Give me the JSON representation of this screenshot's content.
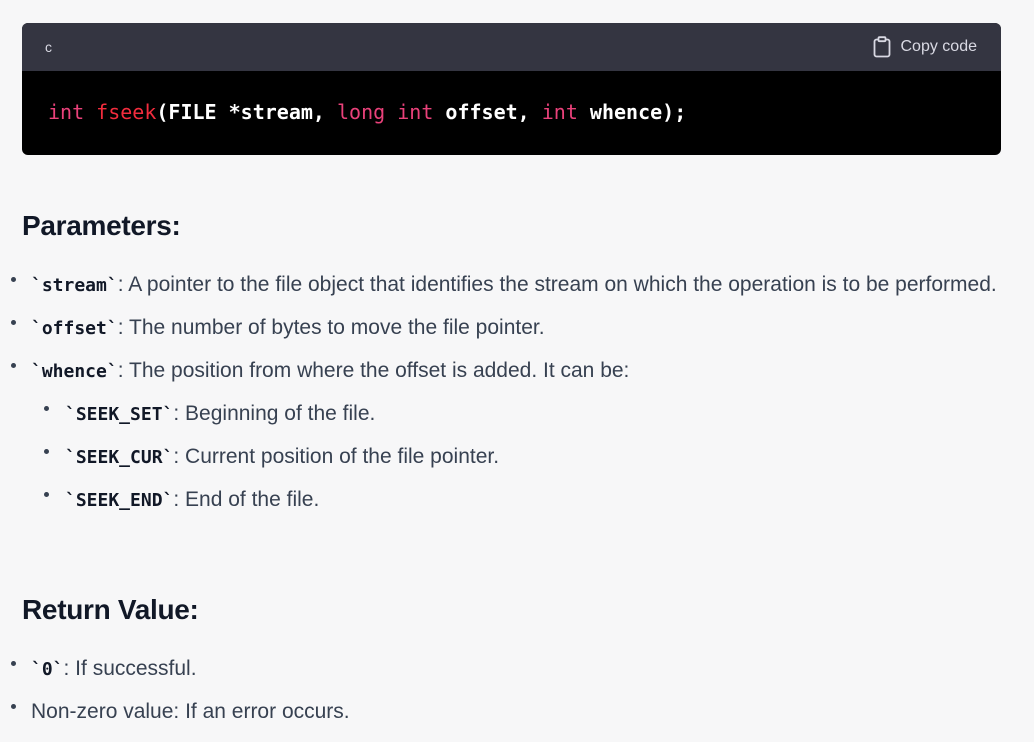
{
  "code_block": {
    "language": "c",
    "copy_label": "Copy code",
    "tokens": {
      "t1": "int",
      "t2": "fseek",
      "t3": "(FILE *stream, ",
      "t4": "long",
      "t5": " ",
      "t6": "int",
      "t7": " offset, ",
      "t8": "int",
      "t9": " whence);"
    }
  },
  "parameters": {
    "heading": "Parameters:",
    "items": [
      {
        "code": "`stream`",
        "text": ": A pointer to the file object that identifies the stream on which the operation is to be performed."
      },
      {
        "code": "`offset`",
        "text": ": The number of bytes to move the file pointer."
      },
      {
        "code": "`whence`",
        "text": ": The position from where the offset is added. It can be:"
      }
    ],
    "whence_options": [
      {
        "code": "`SEEK_SET`",
        "text": ": Beginning of the file."
      },
      {
        "code": "`SEEK_CUR`",
        "text": ": Current position of the file pointer."
      },
      {
        "code": "`SEEK_END`",
        "text": ": End of the file."
      }
    ]
  },
  "return_value": {
    "heading": "Return Value:",
    "items": [
      {
        "code": "`0`",
        "text": ": If successful."
      },
      {
        "code": "",
        "text": "Non-zero value: If an error occurs."
      }
    ]
  },
  "icons": {
    "copy": "clipboard-icon"
  },
  "colors": {
    "page_bg": "#f7f7f8",
    "code_header_bg": "#343541",
    "code_bg": "#000000",
    "keyword": "#e9417a",
    "function": "#f22c3d"
  }
}
